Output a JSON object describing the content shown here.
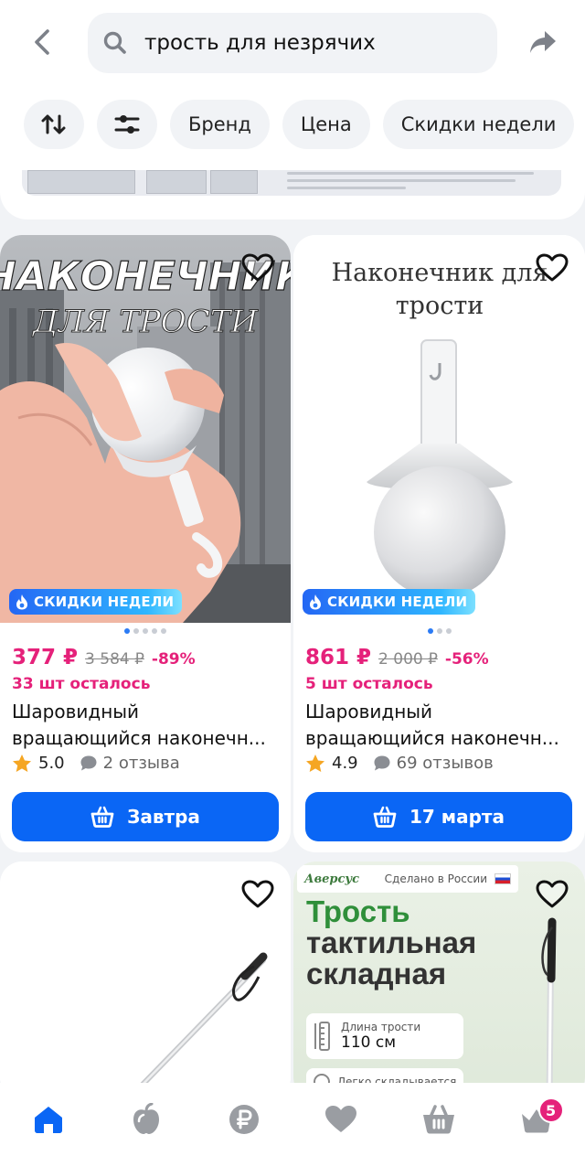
{
  "header": {
    "search": {
      "value": "трость для незрячих"
    },
    "filters": [
      "Бренд",
      "Цена",
      "Скидки недели"
    ]
  },
  "products": [
    {
      "image_title_line1": "НАКОНЕЧНИК",
      "image_title_line2": "ДЛЯ ТРОСТИ",
      "badge": "СКИДКИ НЕДЕЛИ",
      "price": "377 ₽",
      "old_price": "3 584 ₽",
      "discount": "-89%",
      "left": "33 шт осталось",
      "title": "Шаровидный вращающийся наконечн...",
      "title_line1": "Шаровидный",
      "title_line2": "вращающийся наконечн...",
      "rating": "5.0",
      "reviews": "2 отзыва",
      "delivery": "Завтра",
      "image_count": 5,
      "image_active": 0
    },
    {
      "image_title_line1": "Наконечник для",
      "image_title_line2": "трости",
      "badge": "СКИДКИ НЕДЕЛИ",
      "price": "861 ₽",
      "old_price": "2 000 ₽",
      "discount": "-56%",
      "left": "5 шт осталось",
      "title": "Шаровидный вращающийся наконечн...",
      "title_line1": "Шаровидный",
      "title_line2": "вращающийся наконечн...",
      "rating": "4.9",
      "reviews": "69 отзывов",
      "delivery": "17 марта",
      "image_count": 3,
      "image_active": 0
    },
    {},
    {
      "brand": "Аверсус",
      "made_in": "Сделано в России",
      "heading_line1": "Трость",
      "heading_line2": "тактильная",
      "heading_line3": "складная",
      "spec1_label": "Длина трости",
      "spec1_value": "110 см",
      "spec2_label": "Легко складывается"
    }
  ],
  "bottom_nav": {
    "cart_count": "5"
  },
  "colors": {
    "accent": "#0a66f5",
    "price": "#e5217a",
    "background": "#f1f3f6"
  }
}
